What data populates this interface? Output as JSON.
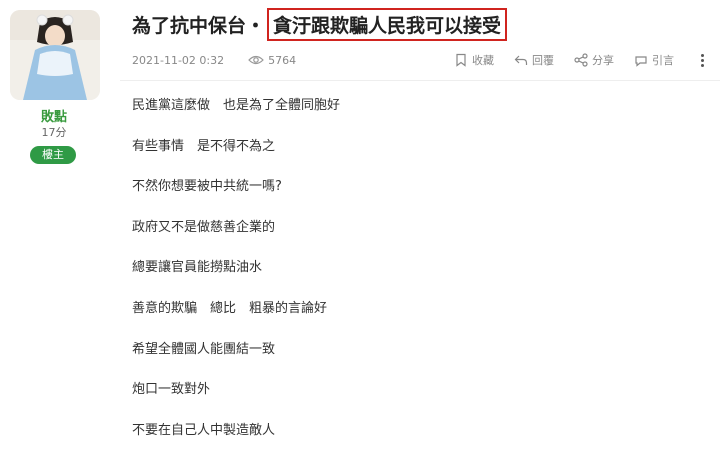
{
  "author": {
    "name": "敗點",
    "level": "17分",
    "badge": "樓主"
  },
  "post": {
    "title_prefix": "為了抗中保台・",
    "title_highlight": "貪汙跟欺騙人民我可以接受",
    "date": "2021-11-02 0:32",
    "views": "5764",
    "actions": {
      "collect": "收藏",
      "reply": "回覆",
      "share": "分享",
      "quote": "引言"
    },
    "lines": [
      "民進黨這麼做　也是為了全體同胞好",
      "有些事情　是不得不為之",
      "不然你想要被中共統一嗎?",
      "政府又不是做慈善企業的",
      "總要讓官員能撈點油水",
      "善意的欺騙　總比　粗暴的言論好",
      "希望全體國人能團結一致",
      "炮口一致對外",
      "不要在自己人中製造敵人"
    ]
  },
  "colors": {
    "accent": "#2f9a45",
    "author": "#3a9b3f",
    "highlight_border": "#d0241f"
  },
  "icons": [
    "eye-icon",
    "bookmark-icon",
    "reply-icon",
    "share-icon",
    "quote-icon",
    "more-icon"
  ]
}
